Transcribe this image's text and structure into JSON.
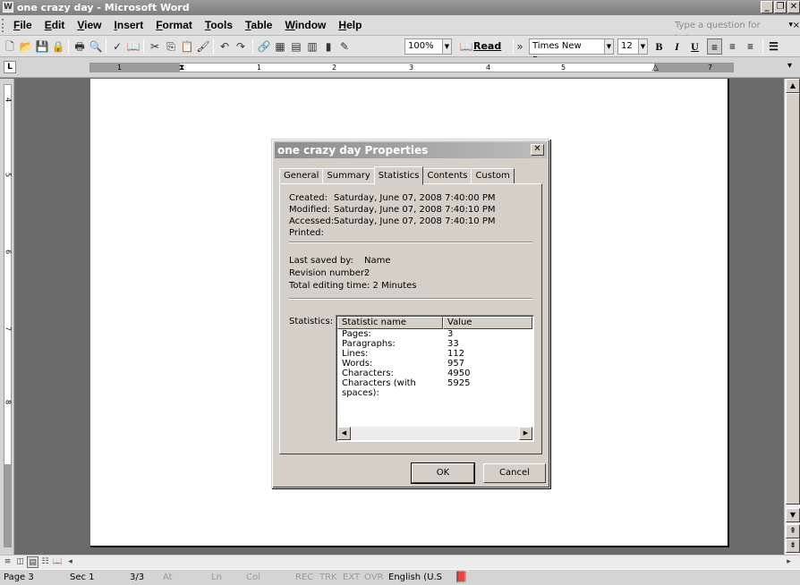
{
  "window": {
    "title": "one crazy day - Microsoft Word",
    "minimize": "_",
    "restore": "❐",
    "close": "✕"
  },
  "menu": {
    "items": [
      "File",
      "Edit",
      "View",
      "Insert",
      "Format",
      "Tools",
      "Table",
      "Window",
      "Help"
    ],
    "help_placeholder": "Type a question for help",
    "help_arrow": "▾",
    "doc_close": "×"
  },
  "toolbar": {
    "zoom": "100%",
    "read_label": "Read",
    "font_name": "Times New Roman",
    "font_size": "12",
    "bold": "B",
    "italic": "I",
    "underline": "U"
  },
  "ruler": {
    "tab_selector": "L",
    "h_numbers": [
      "1",
      "1",
      "2",
      "3",
      "4",
      "5",
      "7"
    ],
    "v_numbers": [
      "4",
      "5",
      "6",
      "7",
      "8"
    ]
  },
  "dialog": {
    "title": "one crazy day Properties",
    "close": "✕",
    "tabs": [
      "General",
      "Summary",
      "Statistics",
      "Contents",
      "Custom"
    ],
    "active_tab": "Statistics",
    "created_label": "Created:",
    "created_value": "Saturday, June 07, 2008 7:40:00 PM",
    "modified_label": "Modified:",
    "modified_value": "Saturday, June 07, 2008 7:40:10 PM",
    "accessed_label": "Accessed:",
    "accessed_value": "Saturday, June 07, 2008 7:40:10 PM",
    "printed_label": "Printed:",
    "printed_value": "",
    "last_saved_label": "Last saved by:",
    "last_saved_value": "Name",
    "revision_label": "Revision number:",
    "revision_value": "2",
    "editing_label": "Total editing time:",
    "editing_value": "2 Minutes",
    "statistics_label": "Statistics:",
    "stats_header": [
      "Statistic name",
      "Value"
    ],
    "stats": [
      {
        "name": "Pages:",
        "value": "3"
      },
      {
        "name": "Paragraphs:",
        "value": "33"
      },
      {
        "name": "Lines:",
        "value": "112"
      },
      {
        "name": "Words:",
        "value": "957"
      },
      {
        "name": "Characters:",
        "value": "4950"
      },
      {
        "name": "Characters (with spaces):",
        "value": "5925"
      }
    ],
    "ok_label": "OK",
    "cancel_label": "Cancel"
  },
  "status": {
    "page": "Page 3",
    "sec": "Sec 1",
    "page_of": "3/3",
    "at": "At",
    "ln": "Ln",
    "col": "Col",
    "rec": "REC",
    "trk": "TRK",
    "ext": "EXT",
    "ovr": "OVR",
    "language": "English (U.S"
  }
}
